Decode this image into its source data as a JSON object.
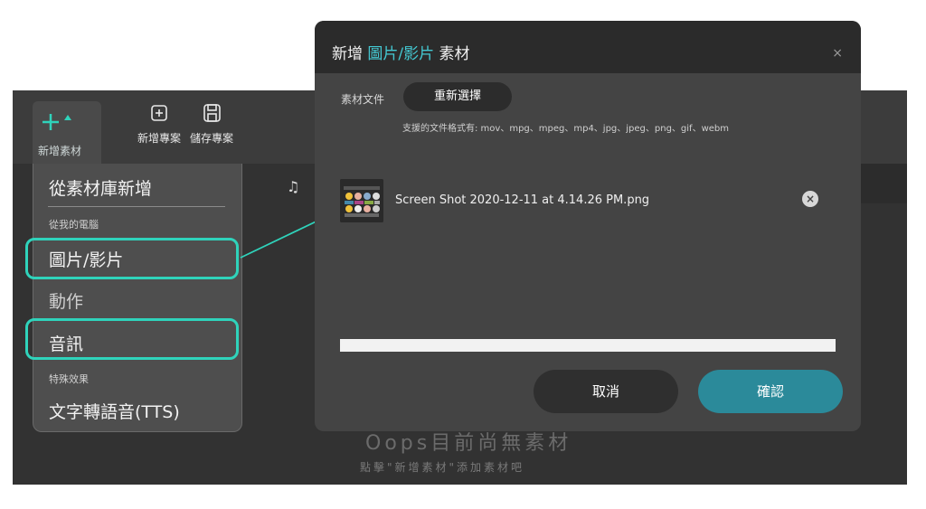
{
  "toolbar": {
    "add_label": "新增素材",
    "new_project_label": "新增專案",
    "save_project_label": "儲存專案"
  },
  "dropdown": {
    "header": "從素材庫新增",
    "from_computer": "從我的電腦",
    "image_video": "圖片/影片",
    "motion": "動作",
    "audio": "音訊",
    "special_effects": "特殊效果",
    "tts": "文字轉語音(TTS)"
  },
  "dialog": {
    "title_prefix": "新增",
    "title_accent": "圖片/影片",
    "title_suffix": "素材",
    "close_icon": "×",
    "file_label": "素材文件",
    "reselect_label": "重新選擇",
    "formats": "支援的文件格式有: mov、mpg、mpeg、mp4、jpg、jpeg、png、gif、webm",
    "file_name": "Screen Shot 2020-12-11 at 4.14.26 PM.png",
    "remove_icon": "×",
    "progress": 1.0,
    "cancel_label": "取消",
    "confirm_label": "確認"
  },
  "empty_state": {
    "title": "Oops目前尚無素材",
    "subtitle": "點擊\"新增素材\"添加素材吧"
  },
  "colors": {
    "highlight": "#2fd3bb",
    "accent": "#44c8d2",
    "confirm": "#2b8a9a"
  }
}
